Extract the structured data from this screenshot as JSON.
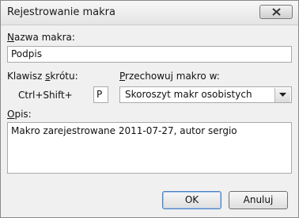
{
  "dialog": {
    "title": "Rejestrowanie makra",
    "close_label": "✕"
  },
  "macro_name": {
    "label_first": "N",
    "label_rest": "azwa makra:",
    "value": "Podpis"
  },
  "shortcut": {
    "label_prefix": "Klawisz ",
    "label_accel": "s",
    "label_suffix": "krótu:",
    "modifier_text": "Ctrl+Shift+",
    "key_value": "P"
  },
  "store": {
    "label_accel": "P",
    "label_rest": "rzechowuj makro w:",
    "selected": "Skoroszyt makr osobistych"
  },
  "description": {
    "label_accel": "O",
    "label_rest": "pis:",
    "value": "Makro zarejestrowane 2011-07-27, autor sergio"
  },
  "buttons": {
    "ok": "OK",
    "cancel": "Anuluj"
  }
}
